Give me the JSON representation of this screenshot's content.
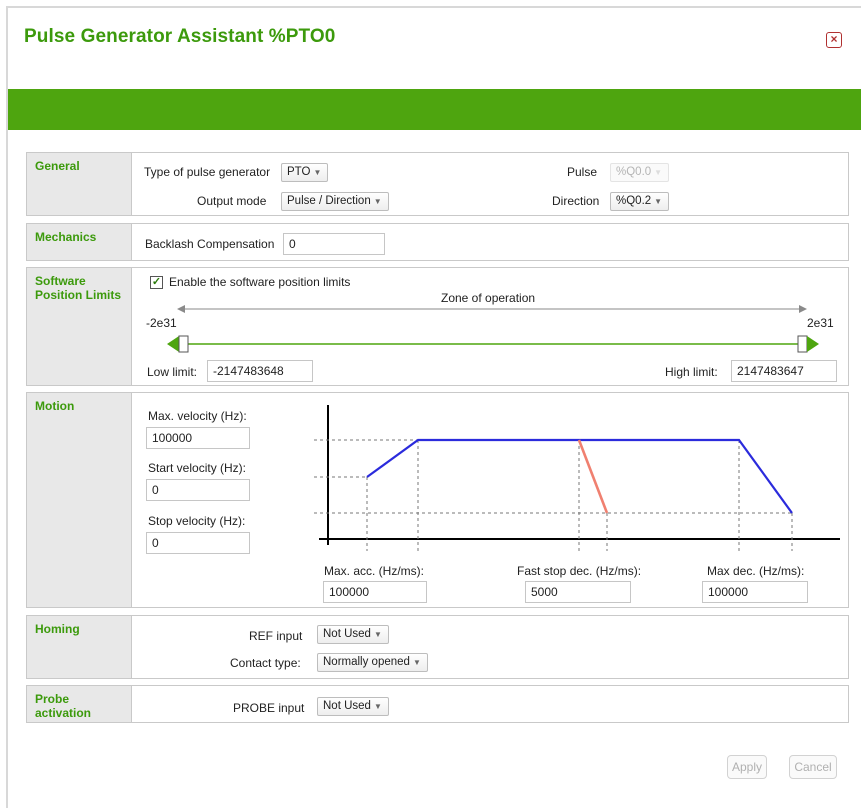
{
  "window": {
    "title": "Pulse Generator Assistant %PTO0",
    "close_label": "×"
  },
  "general": {
    "label": "General",
    "type_label": "Type of pulse generator",
    "type_value": "PTO",
    "output_mode_label": "Output mode",
    "output_mode_value": "Pulse / Direction",
    "pulse_label": "Pulse",
    "pulse_value": "%Q0.0",
    "direction_label": "Direction",
    "direction_value": "%Q0.2"
  },
  "mechanics": {
    "label": "Mechanics",
    "backlash_label": "Backlash Compensation",
    "backlash_value": "0"
  },
  "software_limits": {
    "label": "Software Position Limits",
    "enable_label": "Enable the software position limits",
    "enabled": true,
    "zone_label": "Zone of operation",
    "min_label": "-2e31",
    "max_label": "2e31",
    "low_label": "Low limit:",
    "low_value": "-2147483648",
    "high_label": "High limit:",
    "high_value": "2147483647"
  },
  "motion": {
    "label": "Motion",
    "max_velocity_label": "Max. velocity (Hz):",
    "max_velocity_value": "100000",
    "start_velocity_label": "Start velocity (Hz):",
    "start_velocity_value": "0",
    "stop_velocity_label": "Stop velocity (Hz):",
    "stop_velocity_value": "0",
    "max_acc_label": "Max. acc. (Hz/ms):",
    "max_acc_value": "100000",
    "fast_stop_label": "Fast stop dec. (Hz/ms):",
    "fast_stop_value": "5000",
    "max_dec_label": "Max dec. (Hz/ms):",
    "max_dec_value": "100000",
    "profile_color": "#2b2bdc",
    "fast_stop_color": "#f08070"
  },
  "homing": {
    "label": "Homing",
    "ref_label": "REF input",
    "ref_value": "Not Used",
    "contact_label": "Contact type:",
    "contact_value": "Normally opened"
  },
  "probe": {
    "label": "Probe activation",
    "probe_label": "PROBE input",
    "probe_value": "Not Used"
  },
  "footer": {
    "apply_label": "Apply",
    "cancel_label": "Cancel"
  },
  "colors": {
    "accent": "#3c9a0c",
    "bar": "#4ea50f",
    "close": "#b03030"
  }
}
